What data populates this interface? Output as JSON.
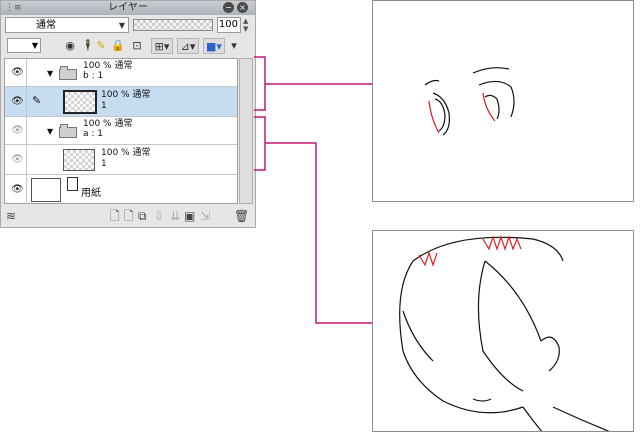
{
  "panel": {
    "title": "レイヤー",
    "blend_mode": "通常",
    "opacity": "100"
  },
  "layers": [
    {
      "opacity": "100 %",
      "mode": "通常",
      "name": "b : 1"
    },
    {
      "opacity": "100 %",
      "mode": "通常",
      "name": "1"
    },
    {
      "opacity": "100 %",
      "mode": "通常",
      "name": "a : 1"
    },
    {
      "opacity": "100 %",
      "mode": "通常",
      "name": "1"
    },
    {
      "name": "用紙"
    }
  ],
  "colors": {
    "connector": "#c21875",
    "accent_red": "#e02020",
    "selected_row": "#c6dcf0"
  },
  "icons": [
    "eye-icon",
    "pen-icon",
    "folder-icon",
    "lock-icon",
    "new-layer-icon",
    "trash-icon"
  ]
}
